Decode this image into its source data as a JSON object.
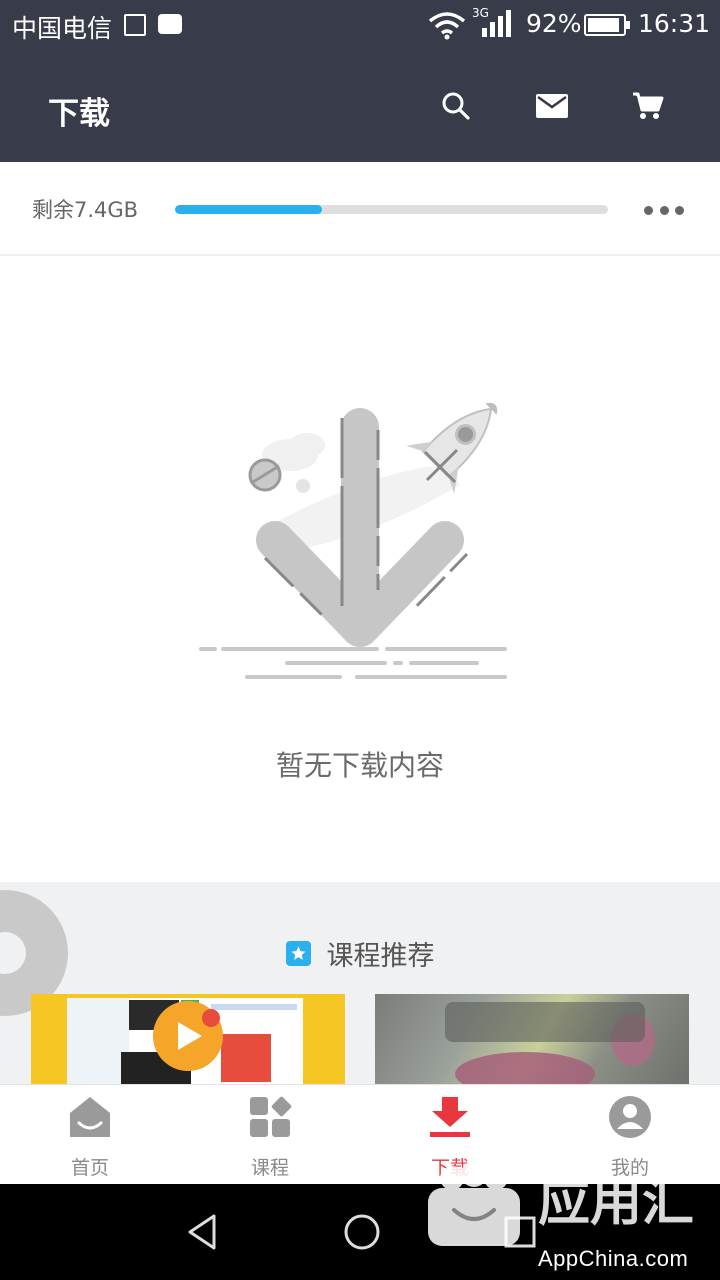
{
  "status_bar": {
    "carrier": "中国电信",
    "network": "3G",
    "battery_pct": "92%",
    "battery_level": 0.92,
    "time": "16:31"
  },
  "header": {
    "title": "下载",
    "icons": [
      "search-icon",
      "mail-icon",
      "cart-icon"
    ]
  },
  "storage": {
    "remaining_label": "剩余7.4GB",
    "used_fraction": 0.34,
    "bar_color": "#2bb0ee"
  },
  "empty_state": {
    "message": "暂无下载内容"
  },
  "recommendations": {
    "title": "课程推荐",
    "badge_color": "#2bb0ee"
  },
  "tabs": [
    {
      "label": "首页",
      "icon": "home-icon",
      "active": false
    },
    {
      "label": "课程",
      "icon": "courses-icon",
      "active": false
    },
    {
      "label": "下载",
      "icon": "download-icon",
      "active": true
    },
    {
      "label": "我的",
      "icon": "profile-icon",
      "active": false
    }
  ],
  "colors": {
    "header_bg": "#373b4a",
    "accent_active": "#e8373f"
  },
  "watermark": {
    "text": "AppChina.com"
  }
}
